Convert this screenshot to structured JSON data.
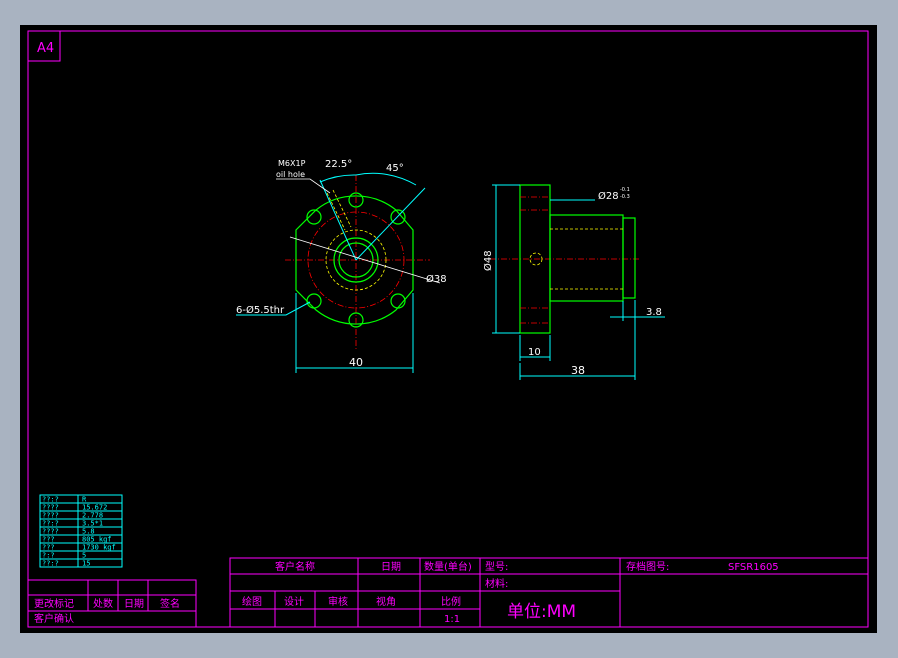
{
  "sheet": {
    "size_label": "A4"
  },
  "colors": {
    "frame": "#ff00ff",
    "dimension": "#00ffff",
    "outline": "#00ff00",
    "center": "#ff0000",
    "hidden": "#ffff00",
    "text": "#ffffff"
  },
  "front_view": {
    "oil_hole_label_1": "M6X1P",
    "oil_hole_label_2": "oil hole",
    "angle_1": "22.5°",
    "angle_2": "45°",
    "bolt_circle": "Ø38",
    "holes": "6-Ø5.5thr",
    "width": "40"
  },
  "side_view": {
    "flange_dia": "Ø48",
    "body_dia": "Ø28",
    "body_tol_upper": "-0.1",
    "body_tol_lower": "-0.3",
    "flange_thk": "10",
    "total_len": "38",
    "groove": "3.8"
  },
  "spec_table": {
    "rows": [
      {
        "label": "??:?",
        "value": "R"
      },
      {
        "label": "????",
        "value": "15.672"
      },
      {
        "label": "????",
        "value": "2.778"
      },
      {
        "label": "??:?",
        "value": "3.5*1"
      },
      {
        "label": "????",
        "value": "5.8"
      },
      {
        "label": "???",
        "value": "805 kgf"
      },
      {
        "label": "???",
        "value": "1730 kgf"
      },
      {
        "label": "?:?",
        "value": "5"
      },
      {
        "label": "??:?",
        "value": "15"
      }
    ]
  },
  "revision": {
    "change_mark": "更改标记",
    "division": "处数",
    "date": "日期",
    "sign": "签名",
    "customer_confirm": "客户确认"
  },
  "title_block": {
    "customer_name": "客户名称",
    "date": "日期",
    "quantity": "数量(单台)",
    "model": "型号:",
    "material": "材料:",
    "archive_no": "存档图号:",
    "archive_value": "SFSR1605",
    "drawn": "绘图",
    "design": "设计",
    "review": "审核",
    "view_angle": "视角",
    "scale_label": "比例",
    "scale_value": "1:1",
    "unit": "单位:MM"
  }
}
